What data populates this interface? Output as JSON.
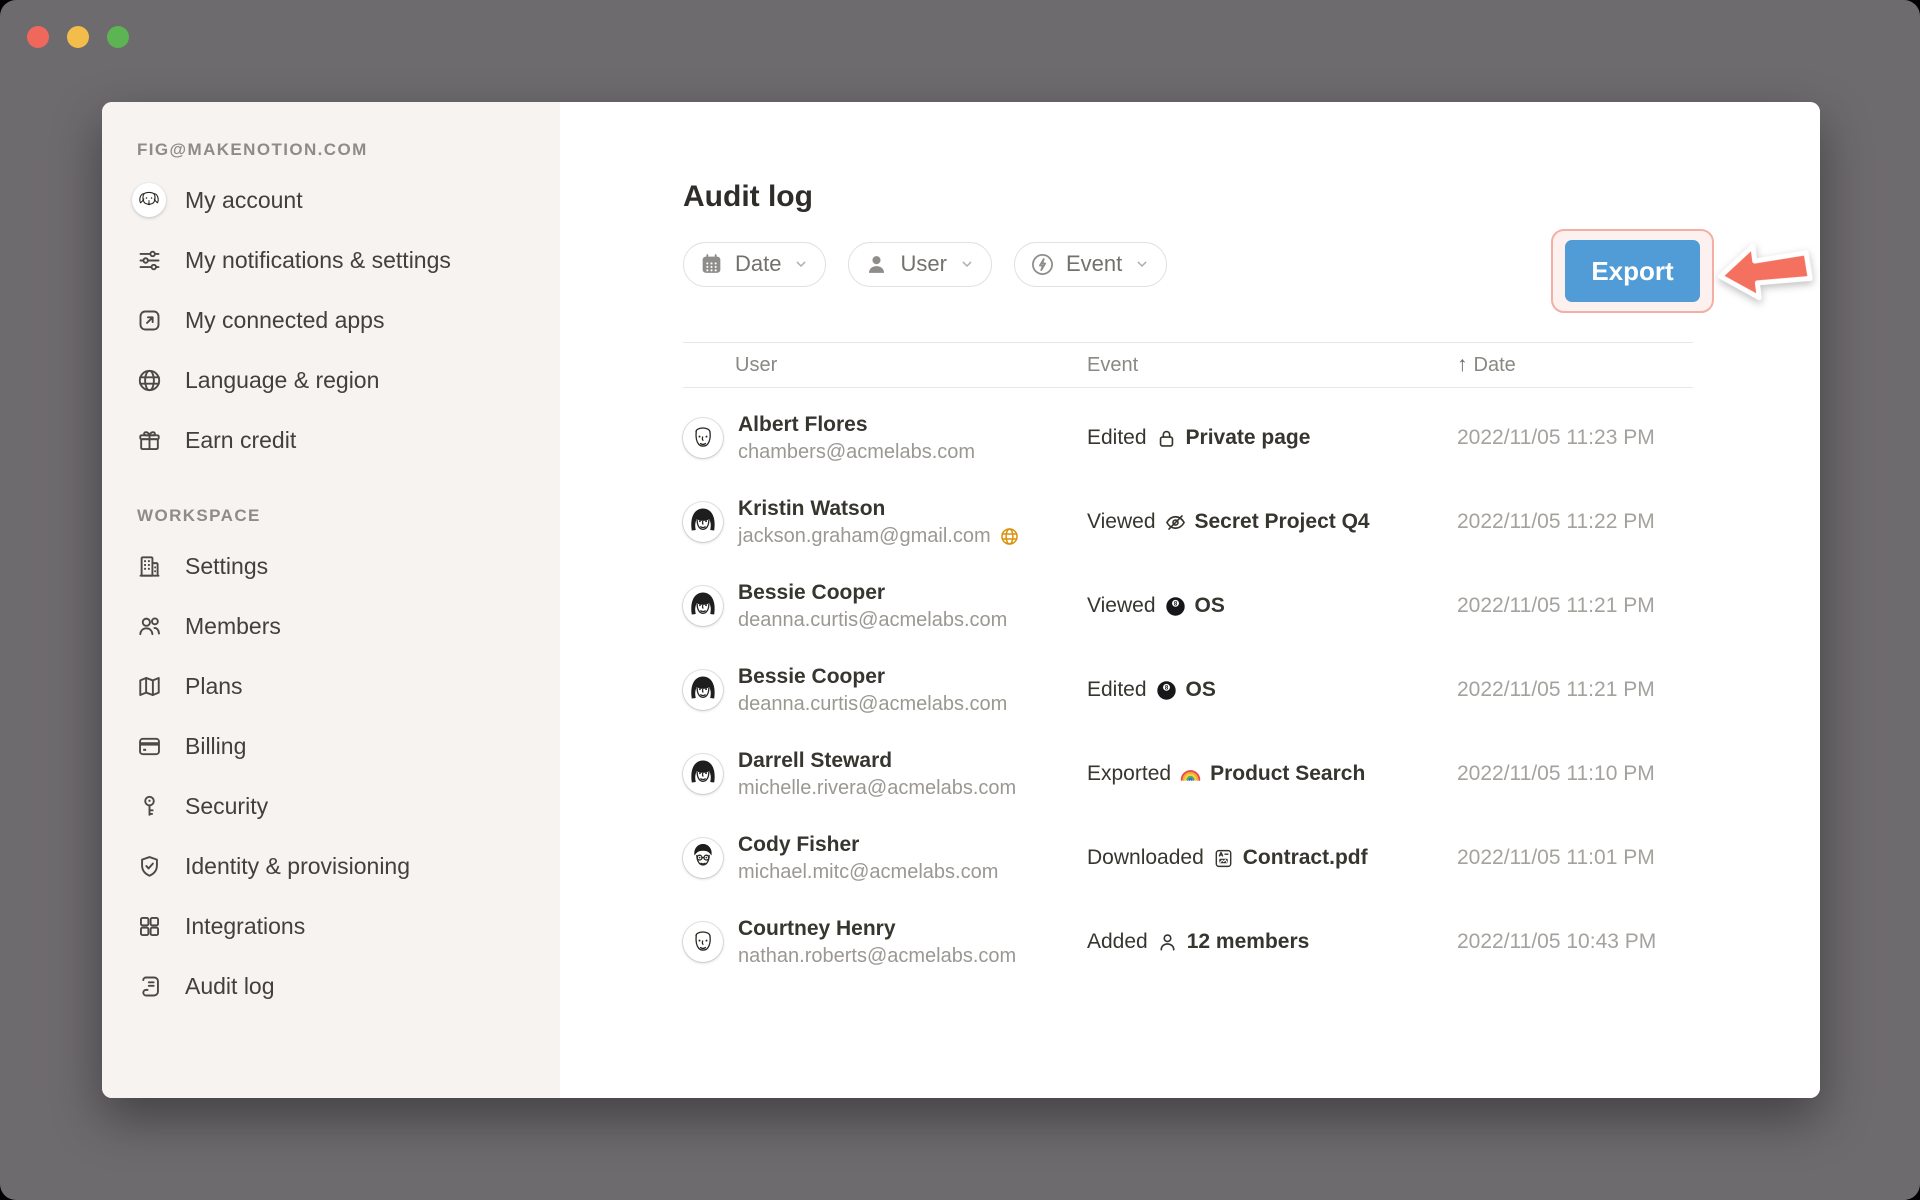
{
  "window": {
    "traffic_lights": [
      {
        "name": "close-window-button",
        "color": "#F0685C"
      },
      {
        "name": "minimize-window-button",
        "color": "#F3BD4C"
      },
      {
        "name": "zoom-window-button",
        "color": "#5CB453"
      }
    ]
  },
  "sidebar": {
    "account_header": "FIG@MAKENOTION.COM",
    "account_items": [
      {
        "icon": "dog-avatar",
        "label": "My account"
      },
      {
        "icon": "sliders-icon",
        "label": "My notifications & settings"
      },
      {
        "icon": "connected-apps-icon",
        "label": "My connected apps"
      },
      {
        "icon": "globe-icon",
        "label": "Language & region"
      },
      {
        "icon": "gift-icon",
        "label": "Earn credit"
      }
    ],
    "workspace_header": "WORKSPACE",
    "workspace_items": [
      {
        "icon": "building-icon",
        "label": "Settings"
      },
      {
        "icon": "members-icon",
        "label": "Members"
      },
      {
        "icon": "map-icon",
        "label": "Plans"
      },
      {
        "icon": "credit-card-icon",
        "label": "Billing"
      },
      {
        "icon": "key-icon",
        "label": "Security"
      },
      {
        "icon": "shield-check-icon",
        "label": "Identity & provisioning"
      },
      {
        "icon": "grid-icon",
        "label": "Integrations"
      },
      {
        "icon": "scroll-icon",
        "label": "Audit log"
      }
    ]
  },
  "main": {
    "title": "Audit log",
    "filters": [
      {
        "icon": "calendar-icon",
        "label": "Date"
      },
      {
        "icon": "user-filled-icon",
        "label": "User"
      },
      {
        "icon": "lightning-icon",
        "label": "Event"
      }
    ],
    "export_label": "Export",
    "table": {
      "columns": [
        "User",
        "Event",
        "Date"
      ],
      "sort_indicator": "↑",
      "rows": [
        {
          "name": "Albert Flores",
          "email": "chambers@acmelabs.com",
          "guest": false,
          "avatar": "sketch-man-light",
          "action": "Edited",
          "object_icon": "lock-icon",
          "object": "Private page",
          "date": "2022/11/05 11:23 PM"
        },
        {
          "name": "Kristin Watson",
          "email": "jackson.graham@gmail.com",
          "guest": true,
          "avatar": "sketch-woman-dark",
          "action": "Viewed",
          "object_icon": "eye-off-icon",
          "object": "Secret Project Q4",
          "date": "2022/11/05 11:22 PM"
        },
        {
          "name": "Bessie Cooper",
          "email": "deanna.curtis@acmelabs.com",
          "guest": false,
          "avatar": "sketch-woman-dark",
          "action": "Viewed",
          "object_icon": "eight-ball-icon",
          "object": "OS",
          "date": "2022/11/05 11:21 PM"
        },
        {
          "name": "Bessie Cooper",
          "email": "deanna.curtis@acmelabs.com",
          "guest": false,
          "avatar": "sketch-woman-dark",
          "action": "Edited",
          "object_icon": "eight-ball-icon",
          "object": "OS",
          "date": "2022/11/05 11:21 PM"
        },
        {
          "name": "Darrell Steward",
          "email": "michelle.rivera@acmelabs.com",
          "guest": false,
          "avatar": "sketch-woman-dark",
          "action": "Exported",
          "object_icon": "rainbow-icon",
          "object": "Product Search",
          "date": "2022/11/05 11:10 PM"
        },
        {
          "name": "Cody Fisher",
          "email": "michael.mitc@acmelabs.com",
          "guest": false,
          "avatar": "sketch-man-dark",
          "action": "Downloaded",
          "object_icon": "document-icon",
          "object": "Contract.pdf",
          "date": "2022/11/05 11:01 PM"
        },
        {
          "name": "Courtney Henry",
          "email": "nathan.roberts@acmelabs.com",
          "guest": false,
          "avatar": "sketch-man-light",
          "action": "Added",
          "object_icon": "person-icon",
          "object": "12 members",
          "date": "2022/11/05 10:43 PM"
        }
      ]
    }
  },
  "colors": {
    "export_button_blue": "#519CD6",
    "annotation_salmon": "#F4705F",
    "annotation_ring_pink": "#F3AFA6",
    "guest_globe_orange": "#D9910B",
    "sidebar_background": "#F7F3F0",
    "desktop_background": "#6E6B6E"
  }
}
